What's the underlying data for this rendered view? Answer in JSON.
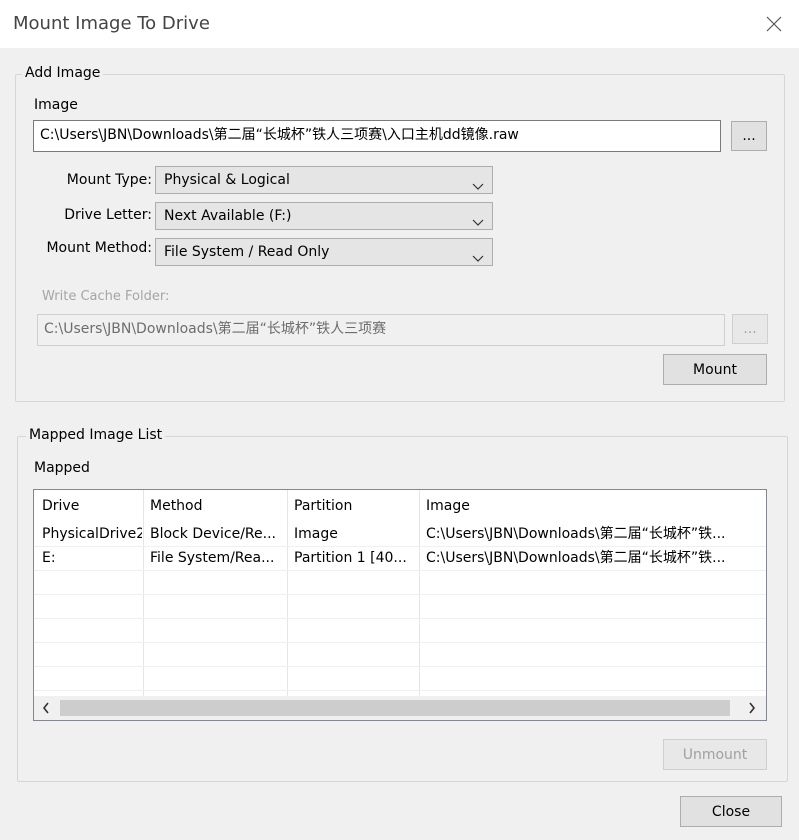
{
  "window": {
    "title": "Mount Image To Drive"
  },
  "add_image": {
    "group_label": "Add Image",
    "image_label": "Image",
    "image_path": "C:\\Users\\JBN\\Downloads\\第二届“长城杯”铁人三项赛\\入口主机dd镜像.raw",
    "browse_label": "...",
    "mount_type_label": "Mount Type:",
    "mount_type_value": "Physical & Logical",
    "drive_letter_label": "Drive Letter:",
    "drive_letter_value": "Next Available (F:)",
    "mount_method_label": "Mount Method:",
    "mount_method_value": "File System / Read Only",
    "write_cache_label": "Write Cache Folder:",
    "write_cache_path": "C:\\Users\\JBN\\Downloads\\第二届“长城杯”铁人三项赛",
    "write_cache_browse_label": "...",
    "mount_button": "Mount"
  },
  "mapped": {
    "group_label": "Mapped Image List",
    "list_label": "Mapped",
    "columns": [
      "Drive",
      "Method",
      "Partition",
      "Image"
    ],
    "rows": [
      [
        "PhysicalDrive2",
        "Block Device/Re...",
        "Image",
        "C:\\Users\\JBN\\Downloads\\第二届“长城杯”铁..."
      ],
      [
        "E:",
        "File System/Rea...",
        "Partition 1 [40...",
        "C:\\Users\\JBN\\Downloads\\第二届“长城杯”铁..."
      ]
    ],
    "unmount_button": "Unmount"
  },
  "footer": {
    "close_button": "Close"
  },
  "colors": {
    "background": "#f0f0f0",
    "title_bg": "#ffffff",
    "disabled_text": "#a0a0a0"
  }
}
